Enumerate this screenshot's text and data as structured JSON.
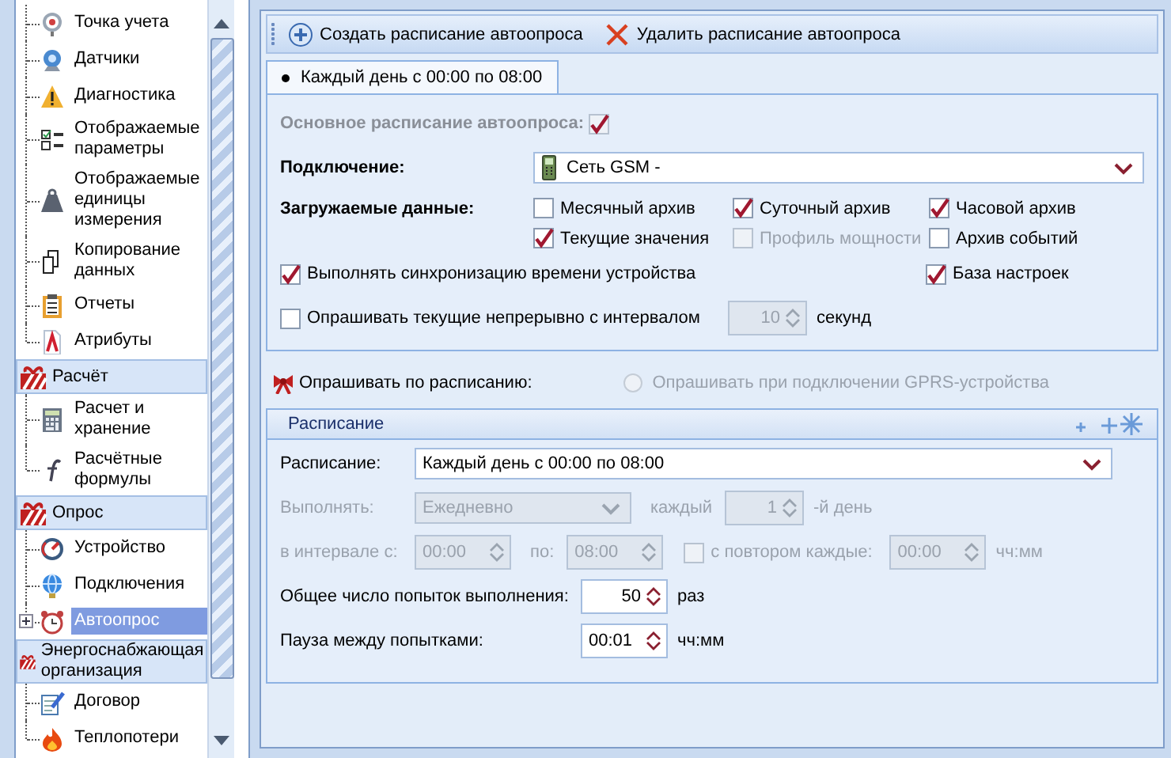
{
  "tree": [
    {
      "kind": "item",
      "label": "Точка учета",
      "selected": false,
      "expandable": false
    },
    {
      "kind": "item",
      "label": "Датчики",
      "selected": false,
      "expandable": false
    },
    {
      "kind": "item",
      "label": "Диагностика",
      "selected": false,
      "expandable": false
    },
    {
      "kind": "item",
      "label": "Отображаемые параметры",
      "selected": false,
      "expandable": false
    },
    {
      "kind": "item",
      "label": "Отображаемые единицы измерения",
      "selected": false,
      "expandable": false
    },
    {
      "kind": "item",
      "label": "Копирование данных",
      "selected": false,
      "expandable": false
    },
    {
      "kind": "item",
      "label": "Отчеты",
      "selected": false,
      "expandable": false
    },
    {
      "kind": "item",
      "label": "Атрибуты",
      "selected": false,
      "expandable": false
    },
    {
      "kind": "group",
      "label": "Расчёт",
      "children": [
        {
          "kind": "item",
          "label": "Расчет и хранение",
          "selected": false,
          "expandable": false
        },
        {
          "kind": "item",
          "label": "Расчётные формулы",
          "selected": false,
          "expandable": false
        }
      ]
    },
    {
      "kind": "group",
      "label": "Опрос",
      "children": [
        {
          "kind": "item",
          "label": "Устройство",
          "selected": false,
          "expandable": false
        },
        {
          "kind": "item",
          "label": "Подключения",
          "selected": false,
          "expandable": false
        },
        {
          "kind": "item",
          "label": "Автоопрос",
          "selected": true,
          "expandable": true
        }
      ]
    },
    {
      "kind": "group",
      "label": "Энергоснабжающая организация",
      "children": [
        {
          "kind": "item",
          "label": "Договор",
          "selected": false,
          "expandable": false
        },
        {
          "kind": "item",
          "label": "Теплопотери",
          "selected": false,
          "expandable": false
        }
      ]
    }
  ],
  "toolbar": {
    "buttons": [
      {
        "label": "Создать расписание автоопроса"
      },
      {
        "label": "Удалить расписание автоопроса"
      }
    ]
  },
  "tabs": [
    {
      "label": "Каждый день с 00:00 по 08:00",
      "selected": true
    }
  ],
  "options": {
    "main_label": "Основное расписание автоопроса:",
    "main_checked": true,
    "connection_label": "Подключение:",
    "connection_value": "Сеть GSM -",
    "data_label": "Загружаемые данные:",
    "data_items": [
      {
        "label": "Месячный архив",
        "checked": false,
        "disabled": false
      },
      {
        "label": "Суточный архив",
        "checked": true,
        "disabled": false
      },
      {
        "label": "Часовой архив",
        "checked": true,
        "disabled": false
      },
      {
        "label": "Текущие значения",
        "checked": true,
        "disabled": false
      },
      {
        "label": "Профиль мощности",
        "checked": false,
        "disabled": true
      },
      {
        "label": "Архив событий",
        "checked": false,
        "disabled": false
      }
    ],
    "sync": {
      "label": "Выполнять синхронизацию времени устройства",
      "checked": true
    },
    "settings_base": {
      "label": "База настроек",
      "checked": true
    },
    "poll": {
      "label": "Опрашивать текущие непрерывно с интервалом",
      "checked": false,
      "value": "10",
      "unit": "секунд",
      "disabled": true
    }
  },
  "by_schedule": {
    "label": "Опрашивать по расписанию:",
    "radio": {
      "label": "Опрашивать при подключении GPRS-устройства",
      "selected": false,
      "disabled": true
    }
  },
  "schedule": {
    "title": "Расписание",
    "label": "Расписание:",
    "value": "Каждый день с 00:00 по 08:00",
    "run": {
      "label": "Выполнять:",
      "value": "Ежедневно",
      "every_label": "каждый",
      "every_value": "1",
      "every_unit": "-й день",
      "disabled": true
    },
    "interval": {
      "from_label": "в интервале с:",
      "from": "00:00",
      "to_label": "по:",
      "to": "08:00",
      "repeat_label": "с повтором каждые:",
      "repeat_checked": false,
      "repeat": "00:00",
      "unit": "чч:мм",
      "disabled": true
    },
    "attempts": {
      "label": "Общее число попыток выполнения:",
      "value": "50",
      "unit": "раз"
    },
    "pause": {
      "label": "Пауза между попытками:",
      "value": "00:01",
      "unit": "чч:мм"
    }
  }
}
